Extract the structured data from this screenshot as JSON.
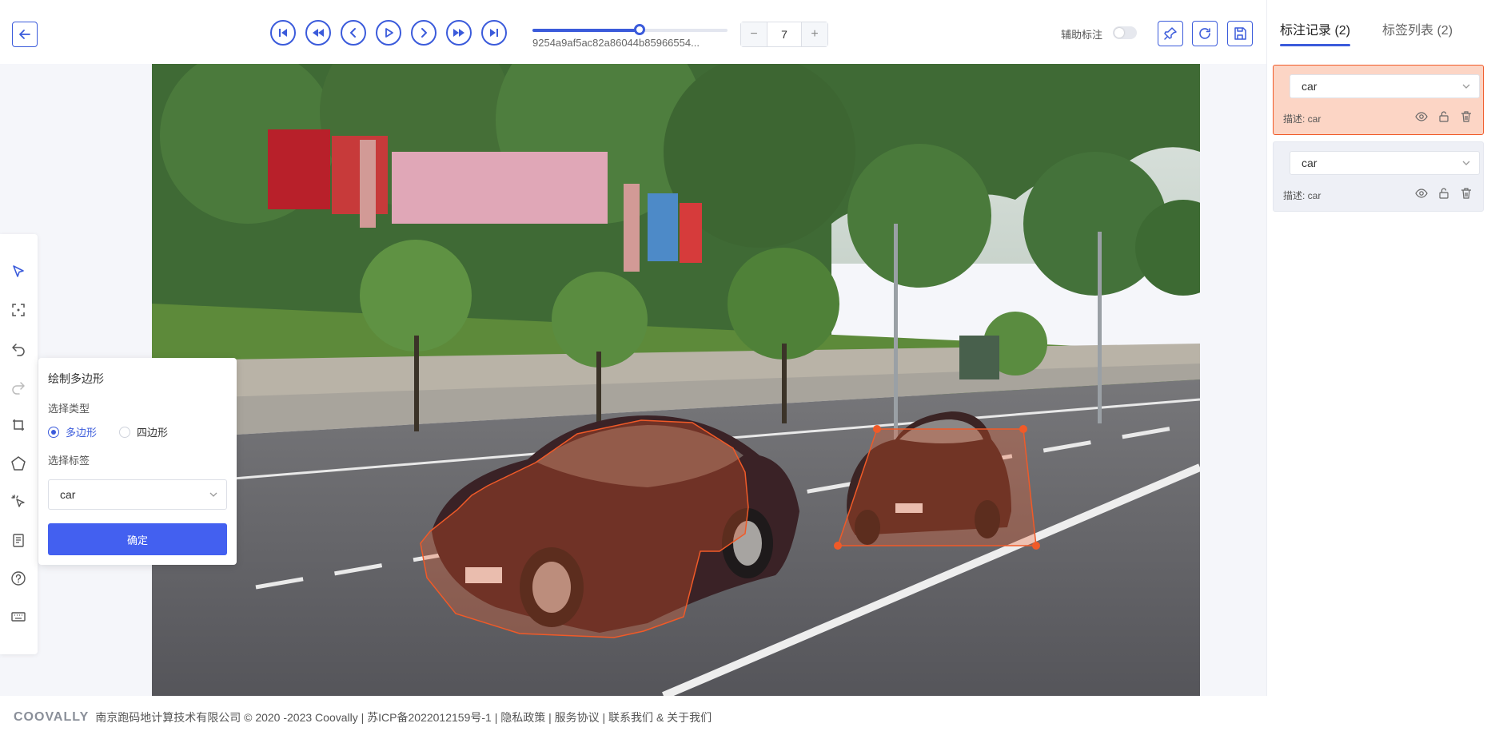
{
  "toolbar": {
    "image_name": "9254a9af5ac82a86044b85966554...",
    "progress": 0.55,
    "page_value": "7",
    "decrement_label": "−",
    "increment_label": "+",
    "assist_label": "辅助标注",
    "assist_enabled": false,
    "accent_color": "#3b5bdb"
  },
  "right_panel": {
    "tabs": [
      {
        "label": "标注记录 (2)",
        "active": true
      },
      {
        "label": "标签列表 (2)",
        "active": false
      }
    ],
    "records": [
      {
        "label": "car",
        "description": "描述: car",
        "selected": true
      },
      {
        "label": "car",
        "description": "描述: car",
        "selected": false
      }
    ],
    "selected_color": "#f05a28"
  },
  "left_tools": [
    {
      "icon": "select-cursor-icon"
    },
    {
      "icon": "rectangle-select-icon"
    },
    {
      "icon": "undo-icon"
    },
    {
      "icon": "redo-icon"
    },
    {
      "icon": "rect-draw-icon"
    },
    {
      "icon": "polygon-draw-icon"
    },
    {
      "icon": "magic-click-icon"
    },
    {
      "icon": "document-icon"
    },
    {
      "icon": "help-icon"
    },
    {
      "icon": "keyboard-icon"
    }
  ],
  "popup": {
    "title": "绘制多边形",
    "type_label": "选择类型",
    "options": [
      {
        "label": "多边形",
        "selected": true
      },
      {
        "label": "四边形",
        "selected": false
      }
    ],
    "tag_label": "选择标签",
    "tag_value": "car",
    "confirm_label": "确定"
  },
  "footer": {
    "logo": "COOVALLY",
    "text": "南京跑码地计算技术有限公司 © 2020 -2023 Coovally | 苏ICP备2022012159号-1 | 隐私政策 | 服务协议 | 联系我们 & 关于我们"
  }
}
